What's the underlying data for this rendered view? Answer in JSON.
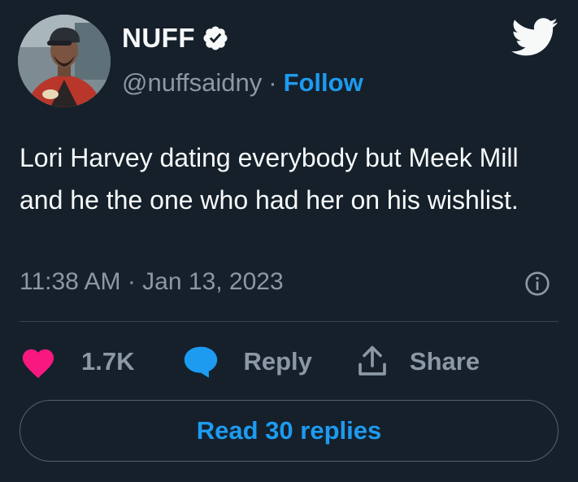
{
  "author": {
    "display_name": "NUFF",
    "handle": "@nuffsaidny",
    "separator": "·",
    "follow_label": "Follow",
    "verified_icon": "verified-badge-icon"
  },
  "brand": {
    "logo_icon": "twitter-bird-icon",
    "accent_color": "#1d9bf0"
  },
  "tweet": {
    "text": "Lori Harvey dating everybody but Meek Mill and he the one who had her on his wishlist.",
    "timestamp": "11:38 AM · Jan 13, 2023"
  },
  "actions": {
    "like_count": "1.7K",
    "like_icon": "heart-icon",
    "like_color": "#f91880",
    "reply_label": "Reply",
    "reply_icon": "speech-bubble-icon",
    "share_label": "Share",
    "share_icon": "share-upload-icon"
  },
  "footer": {
    "read_replies_label": "Read 30 replies"
  },
  "theme": {
    "background": "#15202b",
    "text_primary": "#f7f9f9",
    "text_secondary": "#8b98a5",
    "border": "#38444d"
  }
}
